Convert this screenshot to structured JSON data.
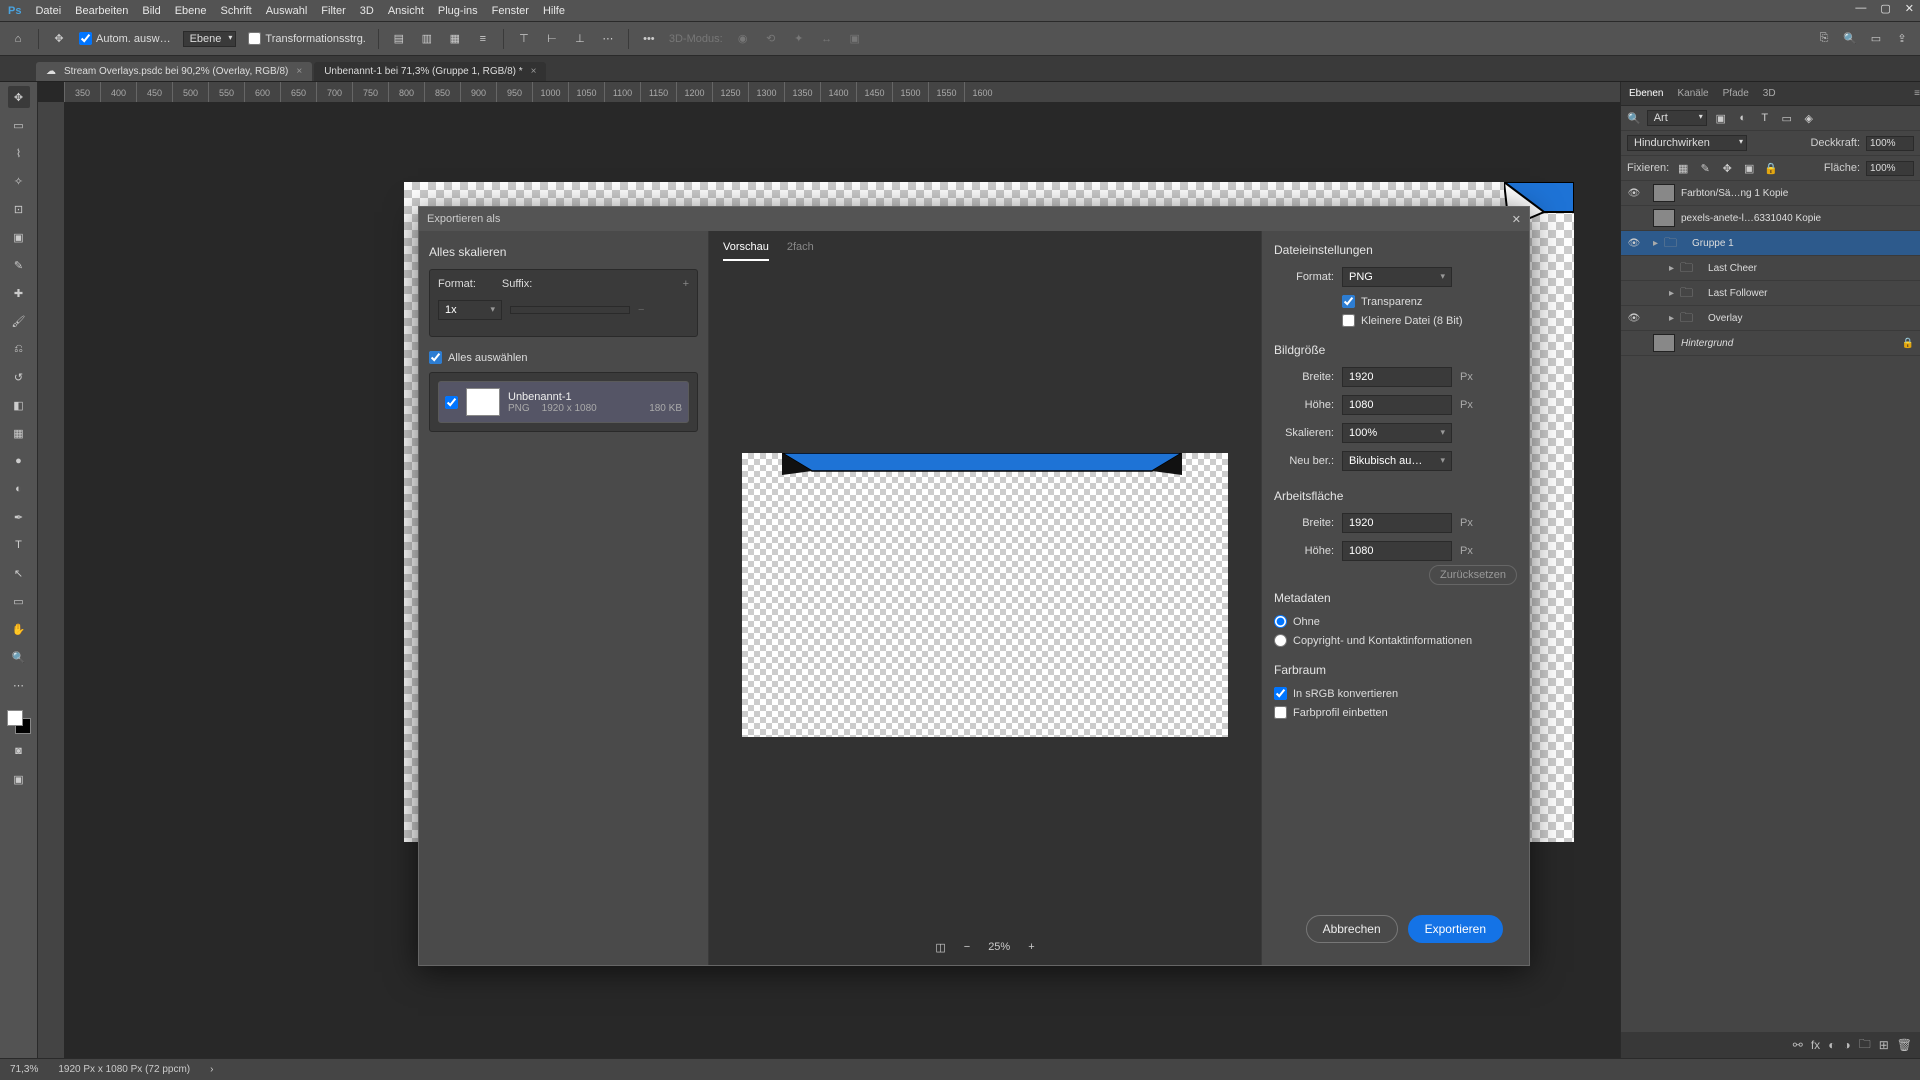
{
  "menu": {
    "items": [
      "Datei",
      "Bearbeiten",
      "Bild",
      "Ebene",
      "Schrift",
      "Auswahl",
      "Filter",
      "3D",
      "Ansicht",
      "Plug-ins",
      "Fenster",
      "Hilfe"
    ]
  },
  "options": {
    "autoSelect": "Autom. ausw…",
    "layerSel": "Ebene",
    "transform": "Transformationsstrg.",
    "mode3d": "3D-Modus:"
  },
  "tabs": [
    {
      "label": "Stream Overlays.psdc bei 90,2% (Overlay, RGB/8)",
      "active": false
    },
    {
      "label": "Unbenannt-1 bei 71,3% (Gruppe 1, RGB/8) *",
      "active": true
    }
  ],
  "ruler": [
    "350",
    "400",
    "450",
    "500",
    "550",
    "600",
    "650",
    "700",
    "750",
    "800",
    "850",
    "900",
    "950",
    "1000",
    "1050",
    "1100",
    "1150",
    "1200",
    "1250",
    "1300",
    "1350",
    "1400",
    "1450",
    "1500",
    "1550",
    "1600"
  ],
  "dialog": {
    "title": "Exportieren als",
    "left": {
      "scaleAll": "Alles skalieren",
      "format": "Format:",
      "suffix": "Suffix:",
      "sizeSel": "1x",
      "selectAll": "Alles auswählen",
      "asset": {
        "name": "Unbenannt-1",
        "fmt": "PNG",
        "dims": "1920 x 1080",
        "size": "180 KB"
      }
    },
    "preview": {
      "tab1": "Vorschau",
      "tab2": "2fach",
      "zoom": "25%"
    },
    "settings": {
      "fileSettings": "Dateieinstellungen",
      "format": "Format:",
      "formatVal": "PNG",
      "transparency": "Transparenz",
      "smaller": "Kleinere Datei (8 Bit)",
      "imageSize": "Bildgröße",
      "width": "Breite:",
      "widthVal": "1920",
      "height": "Höhe:",
      "heightVal": "1080",
      "scale": "Skalieren:",
      "scaleVal": "100%",
      "resample": "Neu ber.:",
      "resampleVal": "Bikubisch au…",
      "canvasSize": "Arbeitsfläche",
      "cWidth": "Breite:",
      "cWidthVal": "1920",
      "cHeight": "Höhe:",
      "cHeightVal": "1080",
      "reset": "Zurücksetzen",
      "metadata": "Metadaten",
      "none": "Ohne",
      "copyright": "Copyright- und Kontaktinformationen",
      "colorspace": "Farbraum",
      "srgb": "In sRGB konvertieren",
      "embed": "Farbprofil einbetten",
      "px": "Px"
    },
    "cancel": "Abbrechen",
    "export": "Exportieren"
  },
  "layers": {
    "tabs": [
      "Ebenen",
      "Kanäle",
      "Pfade",
      "3D"
    ],
    "search": "Art",
    "blend": "Hindurchwirken",
    "opacity": "Deckkraft:",
    "opacityVal": "100%",
    "lock": "Fixieren:",
    "fill": "Fläche:",
    "fillVal": "100%",
    "items": [
      {
        "name": "Farbton/Sä…ng 1 Kopie",
        "eye": true,
        "type": "adj"
      },
      {
        "name": "pexels-anete-l…6331040 Kopie",
        "eye": false,
        "type": "img"
      },
      {
        "name": "Gruppe 1",
        "eye": true,
        "type": "folder",
        "sel": true
      },
      {
        "name": "Last Cheer",
        "eye": false,
        "type": "folder",
        "indent": 1
      },
      {
        "name": "Last Follower",
        "eye": false,
        "type": "folder",
        "indent": 1
      },
      {
        "name": "Overlay",
        "eye": true,
        "type": "folder",
        "indent": 1
      },
      {
        "name": "Hintergrund",
        "eye": false,
        "type": "bg"
      }
    ]
  },
  "status": {
    "zoom": "71,3%",
    "info": "1920 Px x 1080 Px (72 ppcm)"
  }
}
